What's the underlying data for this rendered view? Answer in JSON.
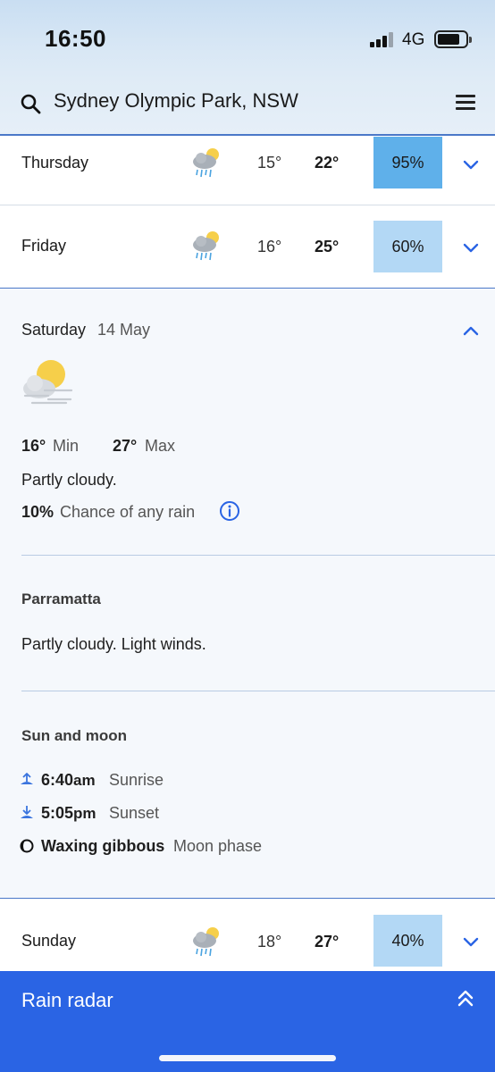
{
  "status_bar": {
    "time": "16:50",
    "network": "4G"
  },
  "header": {
    "location": "Sydney Olympic Park, NSW"
  },
  "forecast_rows": [
    {
      "day": "Thursday",
      "icon": "rain-showers-icon",
      "min": "15°",
      "max": "22°",
      "rain_chance": "95%",
      "rain_color": "#5fb0ea"
    },
    {
      "day": "Friday",
      "icon": "rain-showers-icon",
      "min": "16°",
      "max": "25°",
      "rain_chance": "60%",
      "rain_color": "#b3d8f5"
    },
    {
      "day": "Sunday",
      "icon": "rain-showers-icon",
      "min": "18°",
      "max": "27°",
      "rain_chance": "40%",
      "rain_color": "#b3d8f5"
    }
  ],
  "expanded_day": {
    "day": "Saturday",
    "date": "14 May",
    "icon": "partly-cloudy-icon",
    "min_value": "16°",
    "min_label": "Min",
    "max_value": "27°",
    "max_label": "Max",
    "summary": "Partly cloudy.",
    "rain_value": "10%",
    "rain_label": "Chance of any rain",
    "district": {
      "title": "Parramatta",
      "text": "Partly cloudy. Light winds."
    },
    "sun_moon": {
      "title": "Sun and moon",
      "sunrise_time": "6:40",
      "sunrise_suffix": "am",
      "sunrise_label": "Sunrise",
      "sunset_time": "5:05",
      "sunset_suffix": "pm",
      "sunset_label": "Sunset",
      "moon_value": "Waxing gibbous",
      "moon_label": "Moon phase"
    }
  },
  "rain_radar": {
    "label": "Rain radar"
  },
  "colors": {
    "accent": "#2a64e4",
    "divider": "#4a78c8",
    "chevron": "#2a64e4"
  }
}
